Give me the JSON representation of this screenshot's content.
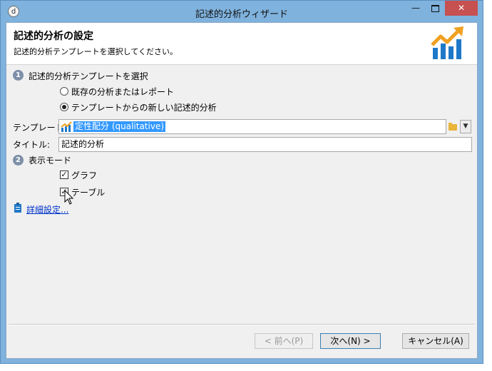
{
  "window": {
    "title": "記述的分析ウィザード",
    "app_icon_glyph": "d",
    "minimize_glyph": "—",
    "close_glyph": "✕"
  },
  "header": {
    "title": "記述的分析の設定",
    "subtitle": "記述的分析テンプレートを選択してください。",
    "icon": "rising-chart-icon",
    "icon_colors": {
      "bars": "#1f78c8",
      "arrow": "#f0a020"
    }
  },
  "step1": {
    "number": "1",
    "label": "記述的分析テンプレートを選択",
    "options": [
      {
        "label": "既存の分析またはレポート",
        "selected": false
      },
      {
        "label": "テンプレートからの新しい記述的分析",
        "selected": true
      }
    ]
  },
  "template": {
    "label": "テンプレート:",
    "value": "定性配分 (qualitative)",
    "icon": "chart-icon",
    "browse_icon": "folder-icon",
    "dropdown_glyph": "▼"
  },
  "title_field": {
    "label": "タイトル:",
    "value": "記述的分析"
  },
  "step2": {
    "number": "2",
    "label": "表示モード",
    "options": [
      {
        "label": "グラフ",
        "checked": true
      },
      {
        "label": "テーブル",
        "checked": true
      }
    ],
    "check_glyph": "✓"
  },
  "advanced": {
    "label": "詳細設定...",
    "icon": "clipboard-icon"
  },
  "buttons": {
    "back": "< 前へ(P)",
    "next": "次へ(N) >",
    "cancel": "キャンセル(A)"
  },
  "colors": {
    "titlebar": "#7fb2dd",
    "close": "#c75050",
    "selection": "#3399ff",
    "link": "#0033cc"
  }
}
